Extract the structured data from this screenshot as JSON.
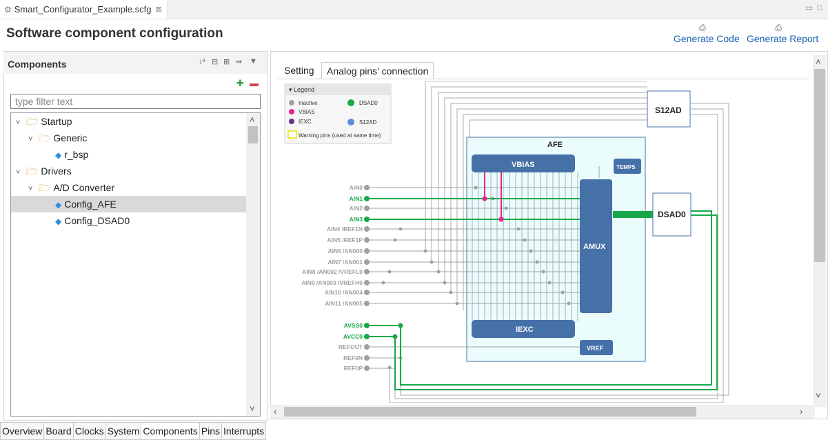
{
  "editor": {
    "tab_title": "Smart_Configurator_Example.scfg",
    "close_glyph": "⊠"
  },
  "page": {
    "heading": "Software component configuration"
  },
  "actions": {
    "generate_code": "Generate Code",
    "generate_report": "Generate Report"
  },
  "components": {
    "title": "Components",
    "filter_placeholder": "type filter text",
    "tree": [
      {
        "label": "Startup",
        "kind": "folder",
        "level": 0
      },
      {
        "label": "Generic",
        "kind": "folder",
        "level": 1
      },
      {
        "label": "r_bsp",
        "kind": "component",
        "level": 2
      },
      {
        "label": "Drivers",
        "kind": "folder",
        "level": 0
      },
      {
        "label": "A/D Converter",
        "kind": "folder",
        "level": 1
      },
      {
        "label": "Config_AFE",
        "kind": "component",
        "level": 2,
        "selected": true
      },
      {
        "label": "Config_DSAD0",
        "kind": "component",
        "level": 2
      }
    ]
  },
  "inner_tabs": {
    "setting": "Setting",
    "analog": "Analog pins’ connection"
  },
  "legend": {
    "title": "Legend",
    "items": [
      {
        "label": "Inactive",
        "color": "#a0a0a0"
      },
      {
        "label": "DSAD0",
        "color": "#18a84a"
      },
      {
        "label": "VBIAS",
        "color": "#e8258a"
      },
      {
        "label": "S12AD",
        "color": "#5b8fd6"
      },
      {
        "label": "IEXC",
        "color": "#6a2c8f"
      }
    ],
    "warning": "Warning pins (used at same time)"
  },
  "diagram": {
    "afe_label": "AFE",
    "vbias": "VBIAS",
    "temps": "TEMPS",
    "amux": "AMUX",
    "iexc": "IEXC",
    "vref": "VREF",
    "s12ad": "S12AD",
    "dsad0": "DSAD0",
    "pins": [
      {
        "label": "AIN0",
        "active": false
      },
      {
        "label": "AIN1",
        "active": true
      },
      {
        "label": "AIN2",
        "active": false
      },
      {
        "label": "AIN3",
        "active": true
      },
      {
        "label": "AIN4 /REF1N",
        "active": false
      },
      {
        "label": "AIN5 /REF1P",
        "active": false
      },
      {
        "label": "AIN6 /AN000",
        "active": false
      },
      {
        "label": "AIN7 /AN001",
        "active": false
      },
      {
        "label": "AIN8 /AN002 /VREFL0",
        "active": false
      },
      {
        "label": "AIN9 /AN003 /VREFH0",
        "active": false
      },
      {
        "label": "AIN10 /AN004",
        "active": false
      },
      {
        "label": "AIN11 /AN005",
        "active": false
      }
    ],
    "power_pins": [
      {
        "label": "AVSS0",
        "active": true
      },
      {
        "label": "AVCC0",
        "active": true
      },
      {
        "label": "REFOUT",
        "active": false
      },
      {
        "label": "REF0N",
        "active": false
      },
      {
        "label": "REF0P",
        "active": false
      }
    ],
    "colors": {
      "inactive": "#a0a0a0",
      "active": "#18a84a",
      "vbias": "#e8258a",
      "block": "#4670a8",
      "afe_bg": "#eafcfc"
    }
  },
  "bottom_tabs": [
    "Overview",
    "Board",
    "Clocks",
    "System",
    "Components",
    "Pins",
    "Interrupts"
  ],
  "bottom_active": "Components"
}
